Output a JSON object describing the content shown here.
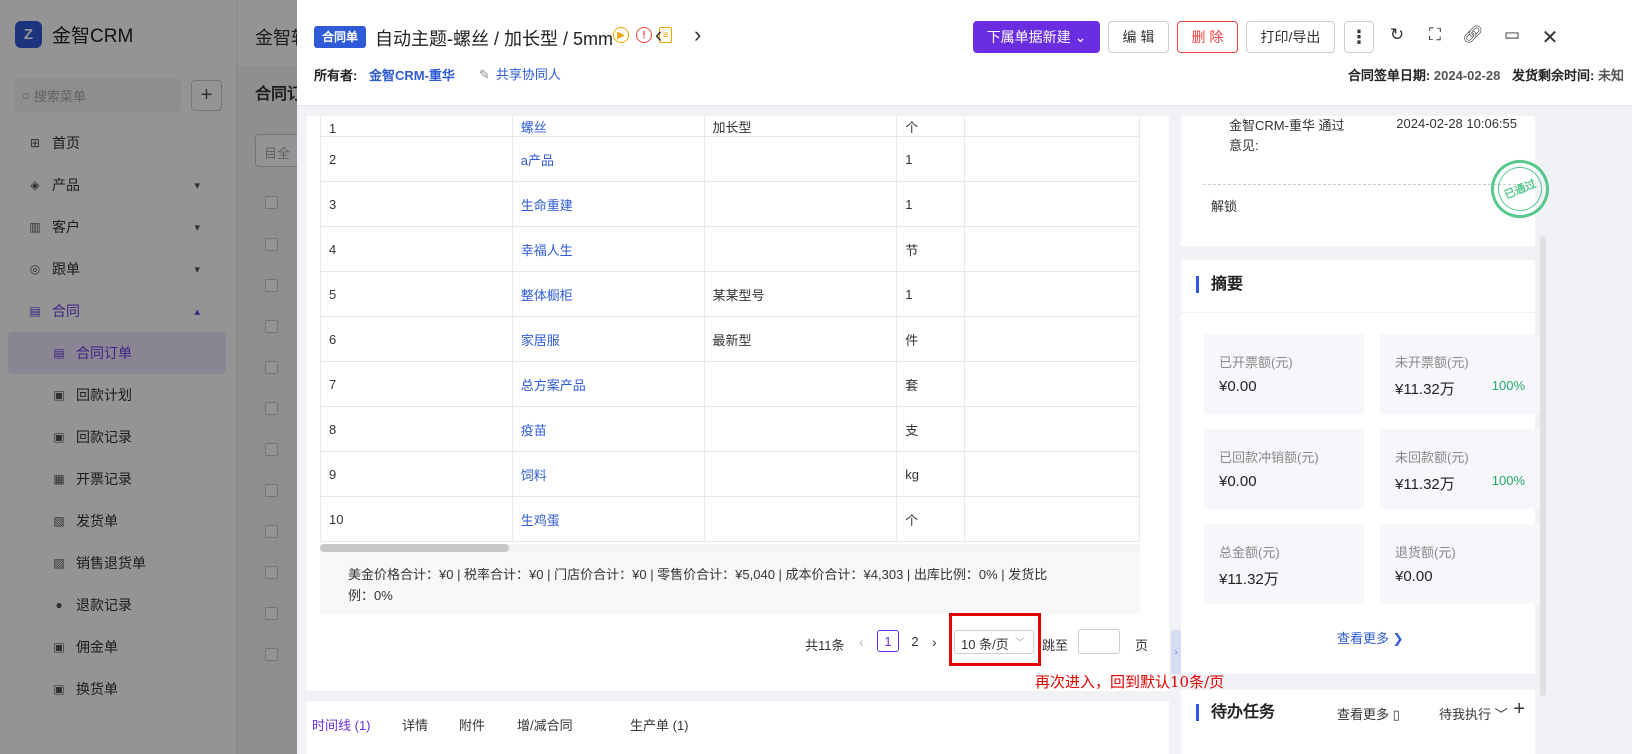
{
  "app": {
    "logo_text": "金智CRM",
    "logo_mark": "Z",
    "search_placeholder": "搜索菜单",
    "top_title": "金智软",
    "main_title": "合同订",
    "main_search": "目全"
  },
  "sidebar": {
    "items": [
      {
        "label": "首页",
        "icon": "home-icon"
      },
      {
        "label": "产品",
        "icon": "box-icon"
      },
      {
        "label": "客户",
        "icon": "customer-icon"
      },
      {
        "label": "跟单",
        "icon": "target-icon"
      },
      {
        "label": "合同",
        "icon": "contract-icon"
      },
      {
        "label": "合同订单",
        "icon": "order-icon"
      },
      {
        "label": "回款计划",
        "icon": "plan-icon"
      },
      {
        "label": "回款记录",
        "icon": "record-icon"
      },
      {
        "label": "开票记录",
        "icon": "invoice-icon"
      },
      {
        "label": "发货单",
        "icon": "shipping-icon"
      },
      {
        "label": "销售退货单",
        "icon": "return-icon"
      },
      {
        "label": "退款记录",
        "icon": "refund-icon"
      },
      {
        "label": "佣金单",
        "icon": "commission-icon"
      },
      {
        "label": "换货单",
        "icon": "exchange-icon"
      }
    ]
  },
  "drawer": {
    "badge": "合同单",
    "title": "自动主题-螺丝 / 加长型 / 5mm",
    "buttons": {
      "new_sub": "下属单据新建",
      "edit": "编 辑",
      "delete": "删 除",
      "print": "打印/导出"
    },
    "owner_label": "所有者:",
    "owner_value": "金智CRM-重华",
    "share_label": "共享协同人",
    "sign_date_label": "合同签单日期:",
    "sign_date_value": "2024-02-28",
    "ship_label": "发货剩余时间:",
    "ship_value": "未知"
  },
  "products": {
    "rows": [
      {
        "no": "1",
        "name": "螺丝",
        "spec": "加长型",
        "unit": "个"
      },
      {
        "no": "2",
        "name": "a产品",
        "spec": "",
        "unit": "1"
      },
      {
        "no": "3",
        "name": "生命重建",
        "spec": "",
        "unit": "1"
      },
      {
        "no": "4",
        "name": "幸福人生",
        "spec": "",
        "unit": "节"
      },
      {
        "no": "5",
        "name": "整体橱柜",
        "spec": "某某型号",
        "unit": "1"
      },
      {
        "no": "6",
        "name": "家居服",
        "spec": "最新型",
        "unit": "件"
      },
      {
        "no": "7",
        "name": "总方案产品",
        "spec": "",
        "unit": "套"
      },
      {
        "no": "8",
        "name": "疫苗",
        "spec": "",
        "unit": "支"
      },
      {
        "no": "9",
        "name": "饲料",
        "spec": "",
        "unit": "kg"
      },
      {
        "no": "10",
        "name": "生鸡蛋",
        "spec": "",
        "unit": "个"
      }
    ],
    "scroll_fraction": 0.23,
    "summary_line1": "美金价格合计：¥0 |   税率合计：¥0 |   门店价合计：¥0 |   零售价合计：¥5,040 |   成本价合计：¥4,303 |   出库比例：0% |   发货比",
    "summary_line2": "例：0%"
  },
  "pager": {
    "total": "共11条",
    "page1": "1",
    "page2": "2",
    "size": "10 条/页",
    "jump": "跳至",
    "unit": "页"
  },
  "annotation": "再次进入，回到默认10条/页",
  "tabs": [
    "时间线 (1)",
    "详情",
    "附件",
    "增/减合同",
    "生产单 (1)"
  ],
  "approval": {
    "line1": "金智CRM-重华 通过",
    "line2": "意见:",
    "time": "2024-02-28 10:06:55",
    "unlock": "解锁",
    "stamp": "已通过"
  },
  "summary_panel": {
    "title": "摘要",
    "cards": [
      {
        "label": "已开票额(元)",
        "value": "¥0.00",
        "pct": ""
      },
      {
        "label": "未开票额(元)",
        "value": "¥11.32万",
        "pct": "100%"
      },
      {
        "label": "已回款冲销额(元)",
        "value": "¥0.00",
        "pct": ""
      },
      {
        "label": "未回款额(元)",
        "value": "¥11.32万",
        "pct": "100%"
      },
      {
        "label": "总金额(元)",
        "value": "¥11.32万",
        "pct": ""
      },
      {
        "label": "退货额(元)",
        "value": "¥0.00",
        "pct": ""
      }
    ],
    "more": "查看更多"
  },
  "todo": {
    "title": "待办任务",
    "more": "查看更多",
    "filter": "待我执行"
  }
}
